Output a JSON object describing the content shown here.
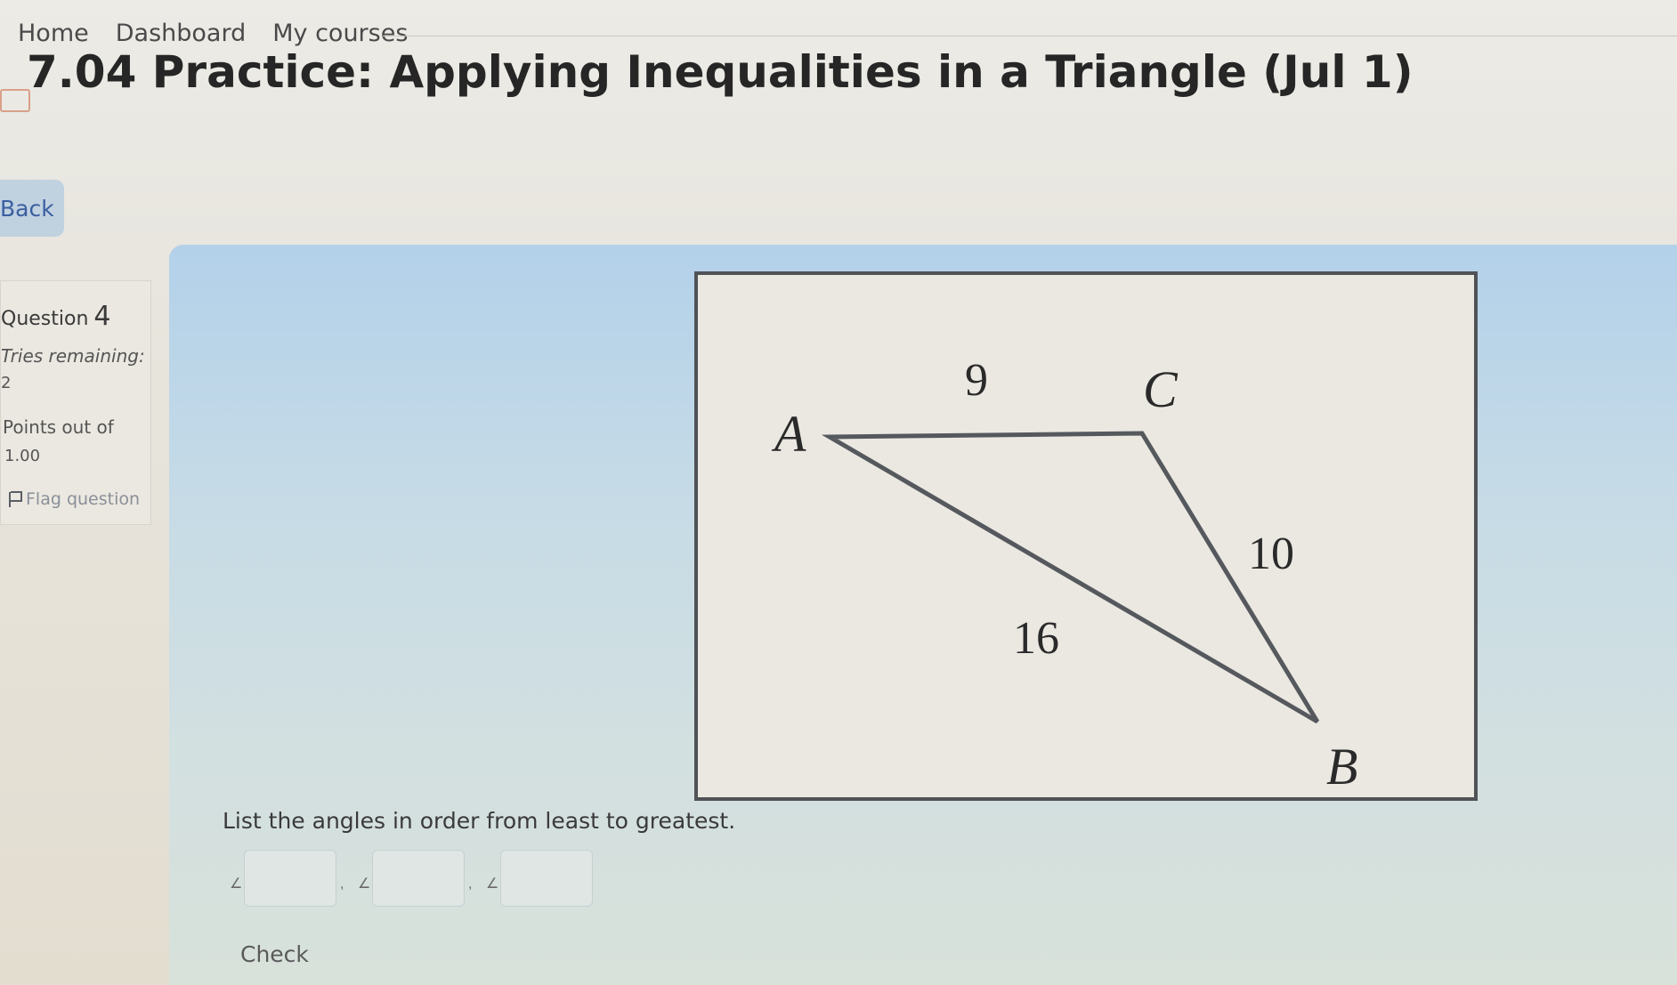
{
  "nav": {
    "home": "Home",
    "dashboard": "Dashboard",
    "my_courses": "My courses"
  },
  "page": {
    "title": "7.04 Practice: Applying Inequalities in a Triangle (Jul 1)",
    "title_icon": "quiz-icon"
  },
  "back": {
    "label": "Back"
  },
  "question_info": {
    "label": "Question",
    "number": "4",
    "tries_label": "Tries remaining:",
    "tries_value": "2",
    "points_label": "Points out of",
    "points_value": "1.00",
    "flag_label": "Flag question",
    "flag_icon": "flag-icon"
  },
  "figure": {
    "vertices": {
      "a": "A",
      "b": "B",
      "c": "C"
    },
    "sides": {
      "ac": "9",
      "cb": "10",
      "ab": "16"
    }
  },
  "question": {
    "prompt": "List the angles in order from least to greatest.",
    "angle_symbol": "∠",
    "separator": ",",
    "answers": [
      "",
      "",
      ""
    ]
  },
  "check": {
    "label": "Check"
  },
  "colors": {
    "back_bg": "#c0d1e0",
    "back_text": "#3a5fa0",
    "content_bg": "#b3d1ea",
    "figure_bg": "#ebe8e2",
    "figure_border": "#4f5256",
    "triangle_stroke": "#55595e"
  }
}
